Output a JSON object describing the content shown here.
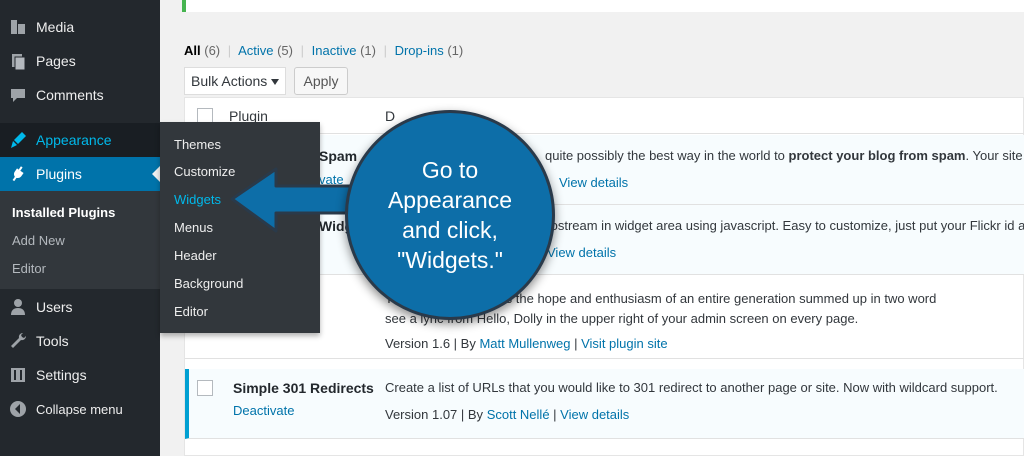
{
  "sidebar": {
    "items": [
      {
        "label": "Media",
        "icon": "media-icon"
      },
      {
        "label": "Pages",
        "icon": "pages-icon"
      },
      {
        "label": "Comments",
        "icon": "comments-icon"
      },
      {
        "label": "Appearance",
        "icon": "appearance-icon"
      },
      {
        "label": "Plugins",
        "icon": "plugins-icon"
      },
      {
        "label": "Users",
        "icon": "users-icon"
      },
      {
        "label": "Tools",
        "icon": "tools-icon"
      },
      {
        "label": "Settings",
        "icon": "settings-icon"
      },
      {
        "label": "Collapse menu",
        "icon": "collapse-icon"
      }
    ],
    "plugins_submenu": [
      "Installed Plugins",
      "Add New",
      "Editor"
    ]
  },
  "flyout": {
    "items": [
      "Themes",
      "Customize",
      "Widgets",
      "Menus",
      "Header",
      "Background",
      "Editor"
    ],
    "active": "Widgets"
  },
  "filters": {
    "all": "All",
    "all_count": "(6)",
    "active": "Active",
    "active_count": "(5)",
    "inactive": "Inactive",
    "inactive_count": "(1)",
    "dropins": "Drop-ins",
    "dropins_count": "(1)",
    "sep": "|"
  },
  "toolbar": {
    "bulk_label": "Bulk Actions",
    "apply_label": "Apply"
  },
  "table": {
    "header_plugin": "Plugin",
    "header_desc": "D",
    "rows": [
      {
        "name": "Spam",
        "action": "vate",
        "desc_pre": "quite possibly the best way in the world to ",
        "desc_bold": "protect your blog from spam",
        "desc_post": ". Your site",
        "meta_link": "View details"
      },
      {
        "name": "Widg",
        "desc": "tostream in widget area using javascript. Easy to customize, just put your Flickr id an",
        "meta_link": "View details"
      },
      {
        "desc": "This   gin, it symbolizes the hope and enthusiasm of an entire generation summed up in two word",
        "desc2": "see a lyric from Hello, Dolly in the upper right of your admin screen on every page.",
        "meta_version": "Version 1.6",
        "meta_by": "By",
        "meta_author": "Matt Mullenweg",
        "meta_link": "Visit plugin site"
      },
      {
        "name": "Simple 301 Redirects",
        "action": "Deactivate",
        "desc": "Create a list of URLs that you would like to 301 redirect to another page or site. Now with wildcard support.",
        "meta_version": "Version 1.07",
        "meta_by": "By",
        "meta_author": "Scott Nellé",
        "meta_link": "View details"
      }
    ]
  },
  "callout": {
    "line1": "Go to",
    "line2": "Appearance",
    "line3": "and click,",
    "line4": "\"Widgets.\""
  },
  "colors": {
    "sidebar": "#23282d",
    "accent": "#0073aa",
    "callout": "#0d6ea8",
    "active_link": "#00b9eb"
  }
}
